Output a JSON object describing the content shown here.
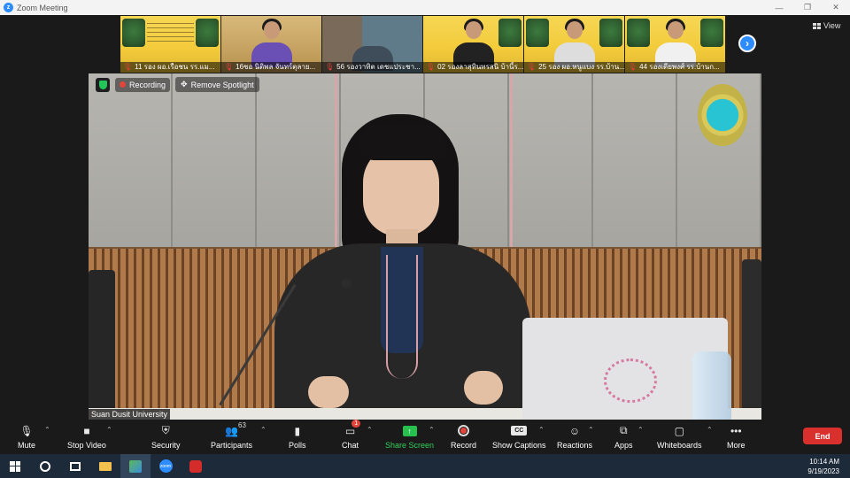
{
  "window": {
    "title": "Zoom Meeting",
    "controls": [
      "—",
      "❐",
      "✕"
    ]
  },
  "view_button": {
    "label": "View"
  },
  "thumbnails": [
    {
      "name": "11 รอง ผอ.เรือชน  รร.แม...",
      "type": "slide"
    },
    {
      "name": "16ชอ นิติพล จันทร์ตุลาย...",
      "type": "person",
      "bg": "#caa46c",
      "shirt": "#6a4fb5"
    },
    {
      "name": "56 รองวาทิต เดชแประชา...",
      "type": "person",
      "bg": "#7c7c7c",
      "shirt": "#444444"
    },
    {
      "name": "02 รองลาสุทินทรสนิ บ้านี้ร...",
      "type": "person",
      "bg": "#e8d89a",
      "shirt": "#222222"
    },
    {
      "name": "25 รอง ผอ.หนูแบง รร.บ้าน...",
      "type": "person",
      "bg": "#e3d08b",
      "shirt": "#dddddd"
    },
    {
      "name": "44 รองเดียพงศ์ รร.บ้านก...",
      "type": "person",
      "bg": "#e2cd86",
      "shirt": "#efefef"
    }
  ],
  "main_video": {
    "recording_label": "Recording",
    "spotlight_label": "Remove Spotlight",
    "participant_name": "Suan Dusit University"
  },
  "toolbar": {
    "mute": "Mute",
    "stop_video": "Stop Video",
    "security": "Security",
    "participants": "Participants",
    "participants_count": "63",
    "polls": "Polls",
    "chat": "Chat",
    "chat_badge": "1",
    "share_screen": "Share Screen",
    "record": "Record",
    "captions": "Show Captions",
    "captions_icon": "CC",
    "reactions": "Reactions",
    "apps": "Apps",
    "whiteboards": "Whiteboards",
    "more": "More",
    "end": "End"
  },
  "taskbar": {
    "time": "10:14 AM",
    "date": "9/19/2023"
  },
  "colors": {
    "accent": "#2d8cff",
    "end": "#d9302d",
    "share": "#27c04e",
    "recording": "#e3453b"
  }
}
